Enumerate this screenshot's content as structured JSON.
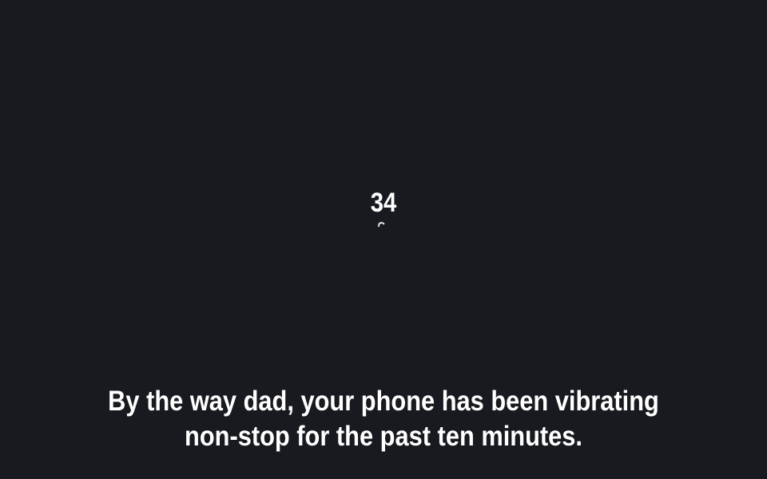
{
  "countdown": {
    "value": "34"
  },
  "subtitle": {
    "line1": "By the way dad, your phone has been vibrating",
    "line2": "non-stop for the past ten minutes."
  },
  "colors": {
    "background": "#181a1f",
    "text": "#ffffff"
  },
  "icons": {
    "loading": "loading-spinner-icon"
  }
}
